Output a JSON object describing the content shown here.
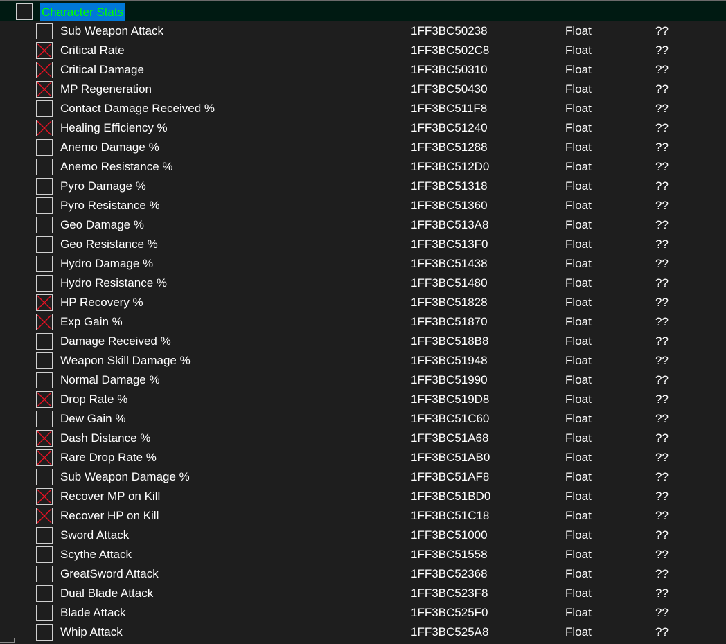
{
  "header": {
    "title": "Character Stats"
  },
  "colors": {
    "background": "#1e1e1e",
    "header_background": "#001a12",
    "selection": "#0078d7",
    "header_text": "#00ff00",
    "check_mark": "#e81123"
  },
  "rows": [
    {
      "description": "Sub Weapon Attack",
      "address": "1FF3BC50238",
      "type": "Float",
      "value": "??",
      "active": false
    },
    {
      "description": "Critical Rate",
      "address": "1FF3BC502C8",
      "type": "Float",
      "value": "??",
      "active": true
    },
    {
      "description": "Critical Damage",
      "address": "1FF3BC50310",
      "type": "Float",
      "value": "??",
      "active": true
    },
    {
      "description": "MP Regeneration",
      "address": "1FF3BC50430",
      "type": "Float",
      "value": "??",
      "active": true
    },
    {
      "description": "Contact Damage Received %",
      "address": "1FF3BC511F8",
      "type": "Float",
      "value": "??",
      "active": false
    },
    {
      "description": "Healing Efficiency %",
      "address": "1FF3BC51240",
      "type": "Float",
      "value": "??",
      "active": true
    },
    {
      "description": "Anemo Damage %",
      "address": "1FF3BC51288",
      "type": "Float",
      "value": "??",
      "active": false
    },
    {
      "description": "Anemo Resistance %",
      "address": "1FF3BC512D0",
      "type": "Float",
      "value": "??",
      "active": false
    },
    {
      "description": "Pyro Damage %",
      "address": "1FF3BC51318",
      "type": "Float",
      "value": "??",
      "active": false
    },
    {
      "description": "Pyro Resistance %",
      "address": "1FF3BC51360",
      "type": "Float",
      "value": "??",
      "active": false
    },
    {
      "description": "Geo Damage %",
      "address": "1FF3BC513A8",
      "type": "Float",
      "value": "??",
      "active": false
    },
    {
      "description": "Geo Resistance %",
      "address": "1FF3BC513F0",
      "type": "Float",
      "value": "??",
      "active": false
    },
    {
      "description": "Hydro Damage %",
      "address": "1FF3BC51438",
      "type": "Float",
      "value": "??",
      "active": false
    },
    {
      "description": "Hydro Resistance %",
      "address": "1FF3BC51480",
      "type": "Float",
      "value": "??",
      "active": false
    },
    {
      "description": "HP Recovery %",
      "address": "1FF3BC51828",
      "type": "Float",
      "value": "??",
      "active": true
    },
    {
      "description": "Exp Gain %",
      "address": "1FF3BC51870",
      "type": "Float",
      "value": "??",
      "active": true
    },
    {
      "description": "Damage Received %",
      "address": "1FF3BC518B8",
      "type": "Float",
      "value": "??",
      "active": false
    },
    {
      "description": "Weapon Skill Damage %",
      "address": "1FF3BC51948",
      "type": "Float",
      "value": "??",
      "active": false
    },
    {
      "description": "Normal Damage %",
      "address": "1FF3BC51990",
      "type": "Float",
      "value": "??",
      "active": false
    },
    {
      "description": "Drop Rate %",
      "address": "1FF3BC519D8",
      "type": "Float",
      "value": "??",
      "active": true
    },
    {
      "description": "Dew Gain %",
      "address": "1FF3BC51C60",
      "type": "Float",
      "value": "??",
      "active": false
    },
    {
      "description": "Dash Distance %",
      "address": "1FF3BC51A68",
      "type": "Float",
      "value": "??",
      "active": true
    },
    {
      "description": "Rare Drop Rate %",
      "address": "1FF3BC51AB0",
      "type": "Float",
      "value": "??",
      "active": true
    },
    {
      "description": "Sub Weapon Damage %",
      "address": "1FF3BC51AF8",
      "type": "Float",
      "value": "??",
      "active": false
    },
    {
      "description": "Recover MP on Kill",
      "address": "1FF3BC51BD0",
      "type": "Float",
      "value": "??",
      "active": true
    },
    {
      "description": "Recover HP on Kill",
      "address": "1FF3BC51C18",
      "type": "Float",
      "value": "??",
      "active": true
    },
    {
      "description": "Sword Attack",
      "address": "1FF3BC51000",
      "type": "Float",
      "value": "??",
      "active": false
    },
    {
      "description": "Scythe Attack",
      "address": "1FF3BC51558",
      "type": "Float",
      "value": "??",
      "active": false
    },
    {
      "description": "GreatSword Attack",
      "address": "1FF3BC52368",
      "type": "Float",
      "value": "??",
      "active": false
    },
    {
      "description": "Dual Blade Attack",
      "address": "1FF3BC523F8",
      "type": "Float",
      "value": "??",
      "active": false
    },
    {
      "description": "Blade Attack",
      "address": "1FF3BC525F0",
      "type": "Float",
      "value": "??",
      "active": false
    },
    {
      "description": "Whip Attack",
      "address": "1FF3BC525A8",
      "type": "Float",
      "value": "??",
      "active": false
    }
  ]
}
